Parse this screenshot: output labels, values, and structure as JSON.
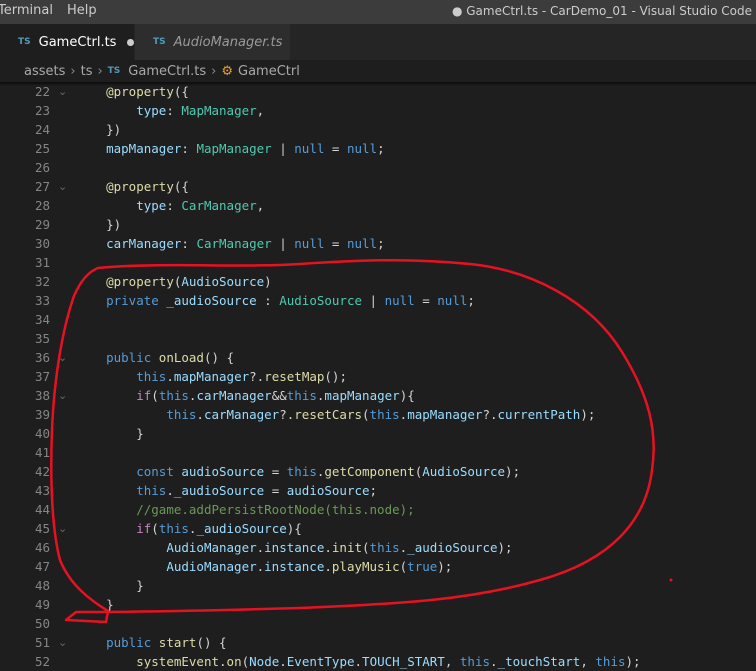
{
  "menu": {
    "items": [
      "Terminal",
      "Help"
    ]
  },
  "window_title": "● GameCtrl.ts - CarDemo_01 - Visual Studio Code",
  "tabs": [
    {
      "icon": "TS",
      "label": "GameCtrl.ts",
      "active": true,
      "dirty": true
    },
    {
      "icon": "TS",
      "label": "AudioManager.ts",
      "active": false
    }
  ],
  "breadcrumb": {
    "items": [
      "assets",
      "ts",
      "GameCtrl.ts",
      "GameCtrl"
    ],
    "icon_file": "TS"
  },
  "colors": {
    "annotation": "#e81123",
    "keyword": "#569cd6",
    "type": "#4ec9b0",
    "control": "#c586c0",
    "comment": "#6a9955"
  },
  "code_lines": [
    {
      "n": "22",
      "fold": true,
      "tokens": [
        [
          "p",
          "    "
        ],
        [
          "f",
          "@property"
        ],
        [
          "p",
          "({"
        ]
      ]
    },
    {
      "n": "23",
      "tokens": [
        [
          "p",
          "        "
        ],
        [
          "v",
          "type"
        ],
        [
          "p",
          ": "
        ],
        [
          "t",
          "MapManager"
        ],
        [
          "p",
          ","
        ]
      ]
    },
    {
      "n": "24",
      "tokens": [
        [
          "p",
          "    })"
        ]
      ]
    },
    {
      "n": "25",
      "tokens": [
        [
          "p",
          "    "
        ],
        [
          "v",
          "mapManager"
        ],
        [
          "p",
          ": "
        ],
        [
          "t",
          "MapManager"
        ],
        [
          "p",
          " | "
        ],
        [
          "k",
          "null"
        ],
        [
          "p",
          " = "
        ],
        [
          "k",
          "null"
        ],
        [
          "p",
          ";"
        ]
      ]
    },
    {
      "n": "26",
      "tokens": []
    },
    {
      "n": "27",
      "fold": true,
      "tokens": [
        [
          "p",
          "    "
        ],
        [
          "f",
          "@property"
        ],
        [
          "p",
          "({"
        ]
      ]
    },
    {
      "n": "28",
      "tokens": [
        [
          "p",
          "        "
        ],
        [
          "v",
          "type"
        ],
        [
          "p",
          ": "
        ],
        [
          "t",
          "CarManager"
        ],
        [
          "p",
          ","
        ]
      ]
    },
    {
      "n": "29",
      "tokens": [
        [
          "p",
          "    })"
        ]
      ]
    },
    {
      "n": "30",
      "tokens": [
        [
          "p",
          "    "
        ],
        [
          "v",
          "carManager"
        ],
        [
          "p",
          ": "
        ],
        [
          "t",
          "CarManager"
        ],
        [
          "p",
          " | "
        ],
        [
          "k",
          "null"
        ],
        [
          "p",
          " = "
        ],
        [
          "k",
          "null"
        ],
        [
          "p",
          ";"
        ]
      ]
    },
    {
      "n": "31",
      "tokens": []
    },
    {
      "n": "32",
      "tokens": [
        [
          "p",
          "    "
        ],
        [
          "f",
          "@property"
        ],
        [
          "p",
          "("
        ],
        [
          "v",
          "AudioSource"
        ],
        [
          "p",
          ")"
        ]
      ]
    },
    {
      "n": "33",
      "tokens": [
        [
          "p",
          "    "
        ],
        [
          "k",
          "private"
        ],
        [
          "p",
          " "
        ],
        [
          "v",
          "_audioSource"
        ],
        [
          "p",
          " : "
        ],
        [
          "t",
          "AudioSource"
        ],
        [
          "p",
          " | "
        ],
        [
          "k",
          "null"
        ],
        [
          "p",
          " = "
        ],
        [
          "k",
          "null"
        ],
        [
          "p",
          ";"
        ]
      ]
    },
    {
      "n": "34",
      "tokens": []
    },
    {
      "n": "35",
      "tokens": []
    },
    {
      "n": "36",
      "fold": true,
      "tokens": [
        [
          "p",
          "    "
        ],
        [
          "k",
          "public"
        ],
        [
          "p",
          " "
        ],
        [
          "f",
          "onLoad"
        ],
        [
          "p",
          "() {"
        ]
      ]
    },
    {
      "n": "37",
      "tokens": [
        [
          "p",
          "        "
        ],
        [
          "k",
          "this"
        ],
        [
          "p",
          "."
        ],
        [
          "v",
          "mapManager"
        ],
        [
          "p",
          "?."
        ],
        [
          "f",
          "resetMap"
        ],
        [
          "p",
          "();"
        ]
      ]
    },
    {
      "n": "38",
      "fold": true,
      "tokens": [
        [
          "p",
          "        "
        ],
        [
          "c",
          "if"
        ],
        [
          "p",
          "("
        ],
        [
          "k",
          "this"
        ],
        [
          "p",
          "."
        ],
        [
          "v",
          "carManager"
        ],
        [
          "p",
          "&&"
        ],
        [
          "k",
          "this"
        ],
        [
          "p",
          "."
        ],
        [
          "v",
          "mapManager"
        ],
        [
          "p",
          "){"
        ]
      ]
    },
    {
      "n": "39",
      "tokens": [
        [
          "p",
          "            "
        ],
        [
          "k",
          "this"
        ],
        [
          "p",
          "."
        ],
        [
          "v",
          "carManager"
        ],
        [
          "p",
          "?."
        ],
        [
          "f",
          "resetCars"
        ],
        [
          "p",
          "("
        ],
        [
          "k",
          "this"
        ],
        [
          "p",
          "."
        ],
        [
          "v",
          "mapManager"
        ],
        [
          "p",
          "?."
        ],
        [
          "v",
          "currentPath"
        ],
        [
          "p",
          ");"
        ]
      ]
    },
    {
      "n": "40",
      "tokens": [
        [
          "p",
          "        }"
        ]
      ]
    },
    {
      "n": "41",
      "tokens": []
    },
    {
      "n": "42",
      "tokens": [
        [
          "p",
          "        "
        ],
        [
          "k",
          "const"
        ],
        [
          "p",
          " "
        ],
        [
          "v",
          "audioSource"
        ],
        [
          "p",
          " = "
        ],
        [
          "k",
          "this"
        ],
        [
          "p",
          "."
        ],
        [
          "f",
          "getComponent"
        ],
        [
          "p",
          "("
        ],
        [
          "v",
          "AudioSource"
        ],
        [
          "p",
          ");"
        ]
      ]
    },
    {
      "n": "43",
      "tokens": [
        [
          "p",
          "        "
        ],
        [
          "k",
          "this"
        ],
        [
          "p",
          "."
        ],
        [
          "v",
          "_audioSource"
        ],
        [
          "p",
          " = "
        ],
        [
          "v",
          "audioSource"
        ],
        [
          "p",
          ";"
        ]
      ]
    },
    {
      "n": "44",
      "tokens": [
        [
          "p",
          "        "
        ],
        [
          "m",
          "//game.addPersistRootNode(this.node);"
        ]
      ]
    },
    {
      "n": "45",
      "fold": true,
      "tokens": [
        [
          "p",
          "        "
        ],
        [
          "c",
          "if"
        ],
        [
          "p",
          "("
        ],
        [
          "k",
          "this"
        ],
        [
          "p",
          "."
        ],
        [
          "v",
          "_audioSource"
        ],
        [
          "p",
          "){"
        ]
      ]
    },
    {
      "n": "46",
      "tokens": [
        [
          "p",
          "            "
        ],
        [
          "v",
          "AudioManager"
        ],
        [
          "p",
          "."
        ],
        [
          "v",
          "instance"
        ],
        [
          "p",
          "."
        ],
        [
          "f",
          "init"
        ],
        [
          "p",
          "("
        ],
        [
          "k",
          "this"
        ],
        [
          "p",
          "."
        ],
        [
          "v",
          "_audioSource"
        ],
        [
          "p",
          ");"
        ]
      ]
    },
    {
      "n": "47",
      "tokens": [
        [
          "p",
          "            "
        ],
        [
          "v",
          "AudioManager"
        ],
        [
          "p",
          "."
        ],
        [
          "v",
          "instance"
        ],
        [
          "p",
          "."
        ],
        [
          "f",
          "playMusic"
        ],
        [
          "p",
          "("
        ],
        [
          "k",
          "true"
        ],
        [
          "p",
          ");"
        ]
      ]
    },
    {
      "n": "48",
      "tokens": [
        [
          "p",
          "        }"
        ]
      ]
    },
    {
      "n": "49",
      "tokens": [
        [
          "p",
          "    }"
        ]
      ]
    },
    {
      "n": "50",
      "tokens": []
    },
    {
      "n": "51",
      "fold": true,
      "tokens": [
        [
          "p",
          "    "
        ],
        [
          "k",
          "public"
        ],
        [
          "p",
          " "
        ],
        [
          "f",
          "start"
        ],
        [
          "p",
          "() {"
        ]
      ]
    },
    {
      "n": "52",
      "tokens": [
        [
          "p",
          "        "
        ],
        [
          "f",
          "systemEvent"
        ],
        [
          "p",
          "."
        ],
        [
          "f",
          "on"
        ],
        [
          "p",
          "("
        ],
        [
          "v",
          "Node"
        ],
        [
          "p",
          "."
        ],
        [
          "v",
          "EventType"
        ],
        [
          "p",
          "."
        ],
        [
          "v",
          "TOUCH_START"
        ],
        [
          "p",
          ", "
        ],
        [
          "k",
          "this"
        ],
        [
          "p",
          "."
        ],
        [
          "v",
          "_touchStart"
        ],
        [
          "p",
          ", "
        ],
        [
          "k",
          "this"
        ],
        [
          "p",
          ");"
        ]
      ]
    }
  ]
}
